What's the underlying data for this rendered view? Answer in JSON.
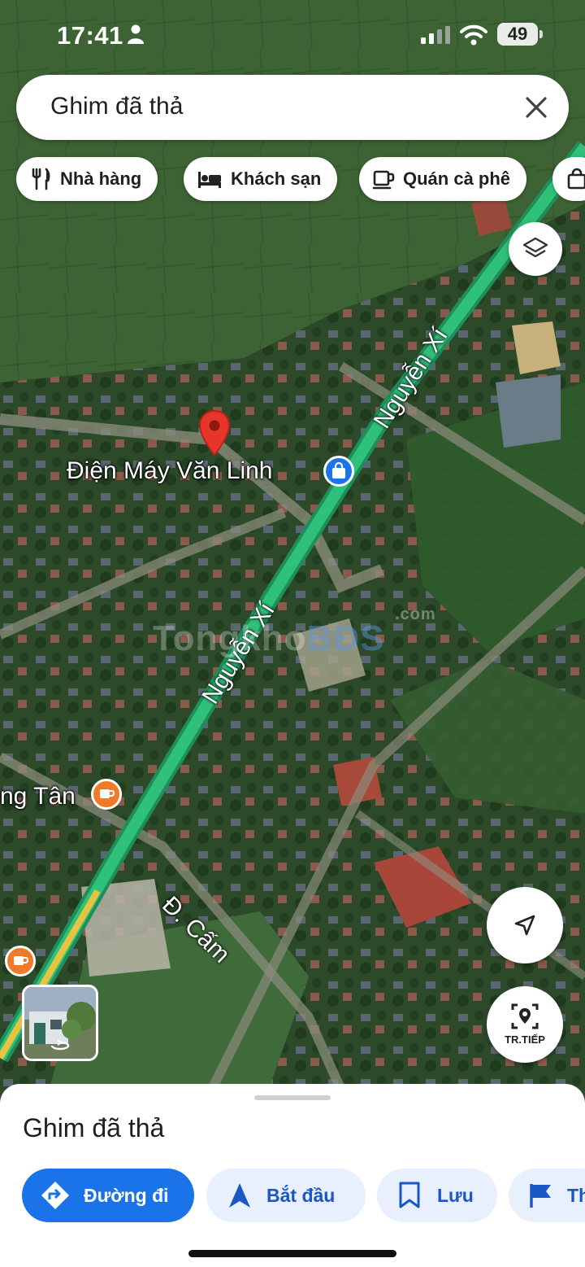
{
  "status_bar": {
    "time": "17:41",
    "battery": "49"
  },
  "search": {
    "text": "Ghim đã thả"
  },
  "chips": [
    {
      "label": "Nhà hàng",
      "icon": "fork-knife-icon"
    },
    {
      "label": "Khách sạn",
      "icon": "bed-icon"
    },
    {
      "label": "Quán cà phê",
      "icon": "coffee-cup-icon"
    }
  ],
  "map": {
    "place_label": "Điện Máy Văn Linh",
    "cafe_label": "ng Tân",
    "road_upper": "Nguyễn Xí",
    "road_lower": "Nguyễn Xí",
    "road_cam": "Đ. Cấm",
    "watermark_text": "Tongkho",
    "watermark_text_2": "BĐS",
    "watermark_sup": ".com",
    "accent_color": "#1a73e8",
    "road_color": "#2fc17a"
  },
  "controls": {
    "streetview_label": "TR.TIẾP"
  },
  "sheet": {
    "title": "Ghim đã thả",
    "actions": [
      {
        "label": "Đường đi",
        "icon": "directions-icon"
      },
      {
        "label": "Bắt đầu",
        "icon": "navigation-arrow-icon"
      },
      {
        "label": "Lưu",
        "icon": "bookmark-icon"
      },
      {
        "label": "Th",
        "icon": "flag-icon"
      }
    ]
  }
}
